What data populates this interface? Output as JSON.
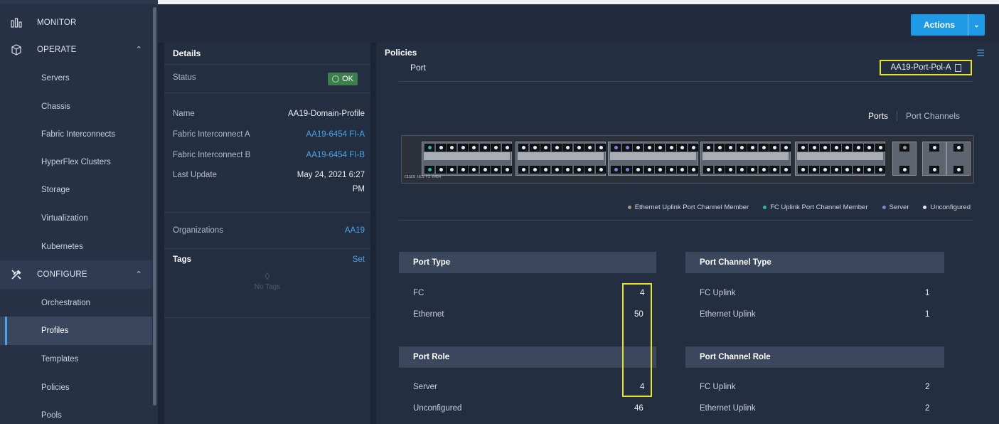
{
  "sidebar": {
    "sections": {
      "monitor": "MONITOR",
      "operate": "OPERATE",
      "configure": "CONFIGURE"
    },
    "operate_items": [
      "Servers",
      "Chassis",
      "Fabric Interconnects",
      "HyperFlex Clusters",
      "Storage",
      "Virtualization",
      "Kubernetes"
    ],
    "configure_items": [
      "Orchestration",
      "Profiles",
      "Templates",
      "Policies",
      "Pools"
    ],
    "active_item": "Profiles"
  },
  "toolbar": {
    "actions_label": "Actions"
  },
  "details": {
    "title": "Details",
    "status_label": "Status",
    "status_value": "OK",
    "name_label": "Name",
    "name_value": "AA19-Domain-Profile",
    "fi_a_label": "Fabric Interconnect A",
    "fi_a_value": "AA19-6454 FI-A",
    "fi_b_label": "Fabric Interconnect B",
    "fi_b_value": "AA19-6454 FI-B",
    "last_update_label": "Last Update",
    "last_update_value_line1": "May 24, 2021 6:27",
    "last_update_value_line2": "PM",
    "org_label": "Organizations",
    "org_value": "AA19",
    "tags_label": "Tags",
    "tags_set": "Set",
    "no_tags": "No Tags"
  },
  "policies": {
    "title": "Policies",
    "port_label": "Port",
    "policy_name": "AA19-Port-Pol-A",
    "tab_ports": "Ports",
    "tab_port_channels": "Port Channels",
    "switch_model": "CISCO UCS-FI-6454",
    "legend": [
      {
        "label": "Ethernet Uplink Port Channel Member",
        "color": "#a39a86"
      },
      {
        "label": "FC Uplink Port Channel Member",
        "color": "#2bb9a4"
      },
      {
        "label": "Server",
        "color": "#8a7fd8"
      },
      {
        "label": "Unconfigured",
        "color": "#e6e9ee"
      }
    ],
    "port_type": {
      "title": "Port Type",
      "rows": [
        {
          "label": "FC",
          "value": "4"
        },
        {
          "label": "Ethernet",
          "value": "50"
        }
      ]
    },
    "port_channel_type": {
      "title": "Port Channel Type",
      "rows": [
        {
          "label": "FC Uplink",
          "value": "1"
        },
        {
          "label": "Ethernet Uplink",
          "value": "1"
        }
      ]
    },
    "port_role": {
      "title": "Port Role",
      "rows": [
        {
          "label": "Server",
          "value": "4"
        },
        {
          "label": "Unconfigured",
          "value": "46"
        }
      ]
    },
    "port_channel_role": {
      "title": "Port Channel Role",
      "rows": [
        {
          "label": "FC Uplink",
          "value": "2"
        },
        {
          "label": "Ethernet Uplink",
          "value": "2"
        }
      ]
    }
  }
}
